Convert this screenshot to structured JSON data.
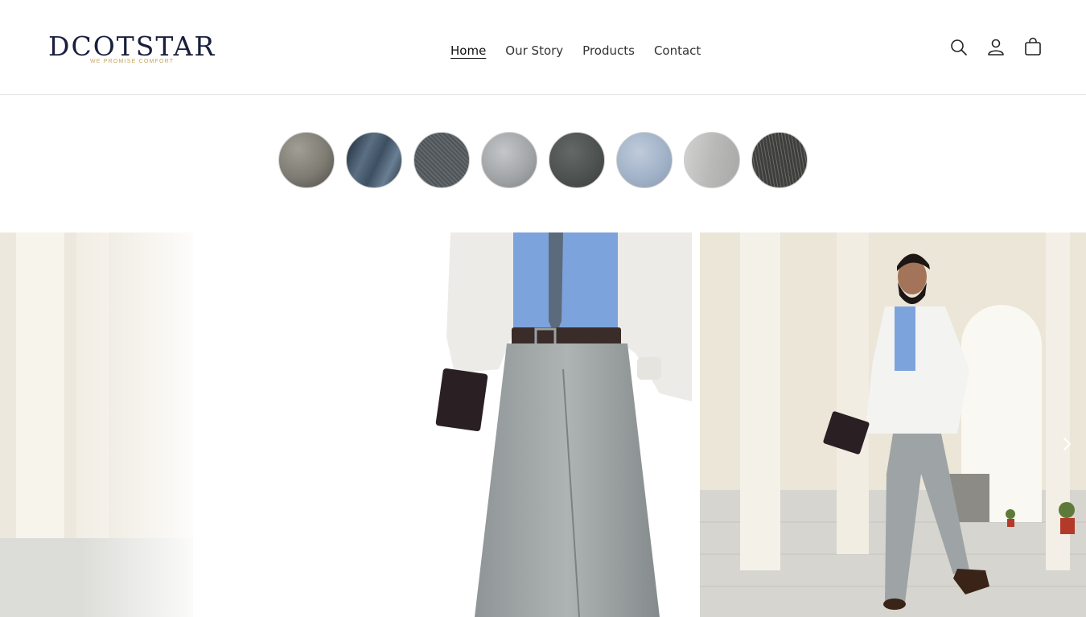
{
  "brand": {
    "name": "DCOTSTAR",
    "tagline": "WE PROMISE COMFORT",
    "text_color": "#1a1f3c",
    "tagline_color": "#c9a55a"
  },
  "nav": {
    "items": [
      "Home",
      "Our Story",
      "Products",
      "Contact"
    ],
    "active": "Home"
  },
  "header_icons": [
    "search-icon",
    "account-icon",
    "cart-icon"
  ],
  "swatches": [
    {
      "name": "fabric-swatch-brown-grey",
      "color": "#7d7b72"
    },
    {
      "name": "fabric-swatch-steel-blue",
      "color": "#3d5062"
    },
    {
      "name": "fabric-swatch-charcoal-weave",
      "color": "#555a5e"
    },
    {
      "name": "fabric-swatch-light-grey",
      "color": "#9fa2a5"
    },
    {
      "name": "fabric-swatch-dark-grey",
      "color": "#4b504f"
    },
    {
      "name": "fabric-swatch-powder-blue",
      "color": "#9fb0c6"
    },
    {
      "name": "fabric-swatch-silver",
      "color": "#b9b9b8"
    },
    {
      "name": "fabric-swatch-pinstripe",
      "color": "#3e3f3d"
    }
  ],
  "hero": {
    "slide_subject": "man in white blazer and grey trousers",
    "next_icon": "chevron-right-icon"
  }
}
